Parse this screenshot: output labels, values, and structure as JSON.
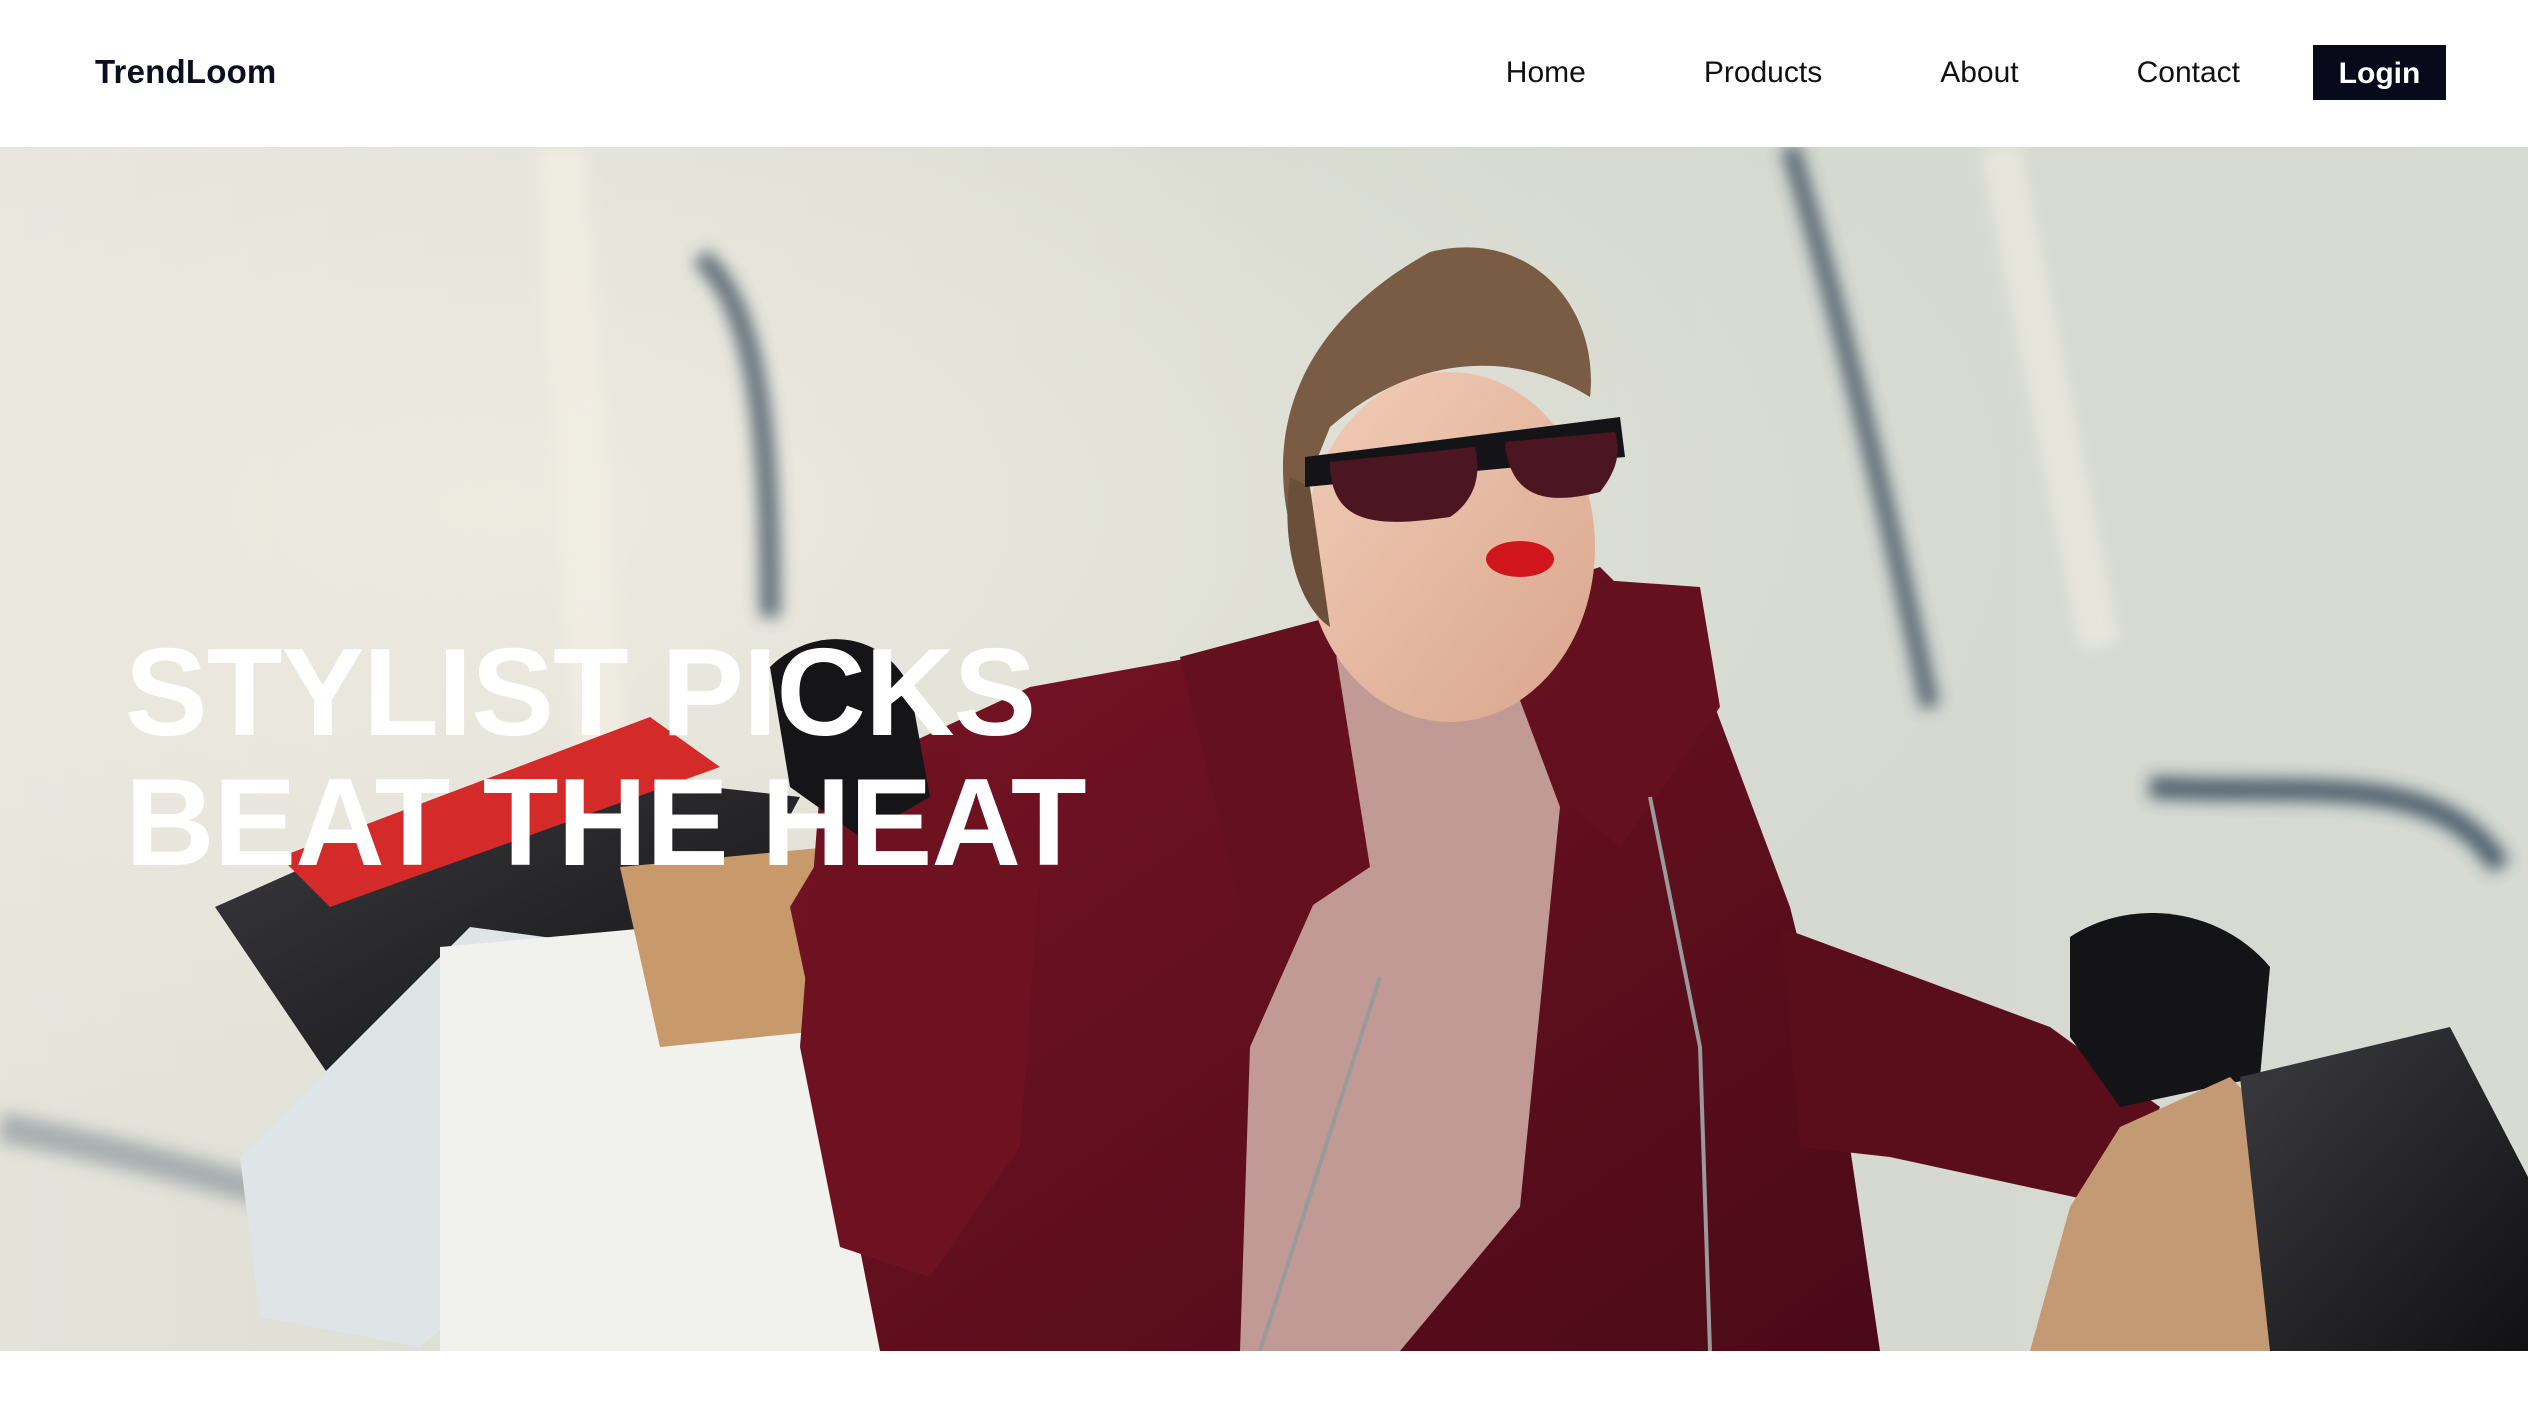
{
  "brand": {
    "name": "TrendLoom"
  },
  "nav": {
    "links": [
      {
        "label": "Home"
      },
      {
        "label": "Products"
      },
      {
        "label": "About"
      },
      {
        "label": "Contact"
      }
    ],
    "login_label": "Login"
  },
  "hero": {
    "title_line_1": "STYLIST PICKS",
    "title_line_2": "BEAT THE HEAT",
    "image": "woman-with-shopping-bags-photo"
  },
  "colors": {
    "brand_dark": "#080a1c",
    "hero_text": "#ffffff",
    "page_bg": "#ffffff"
  }
}
